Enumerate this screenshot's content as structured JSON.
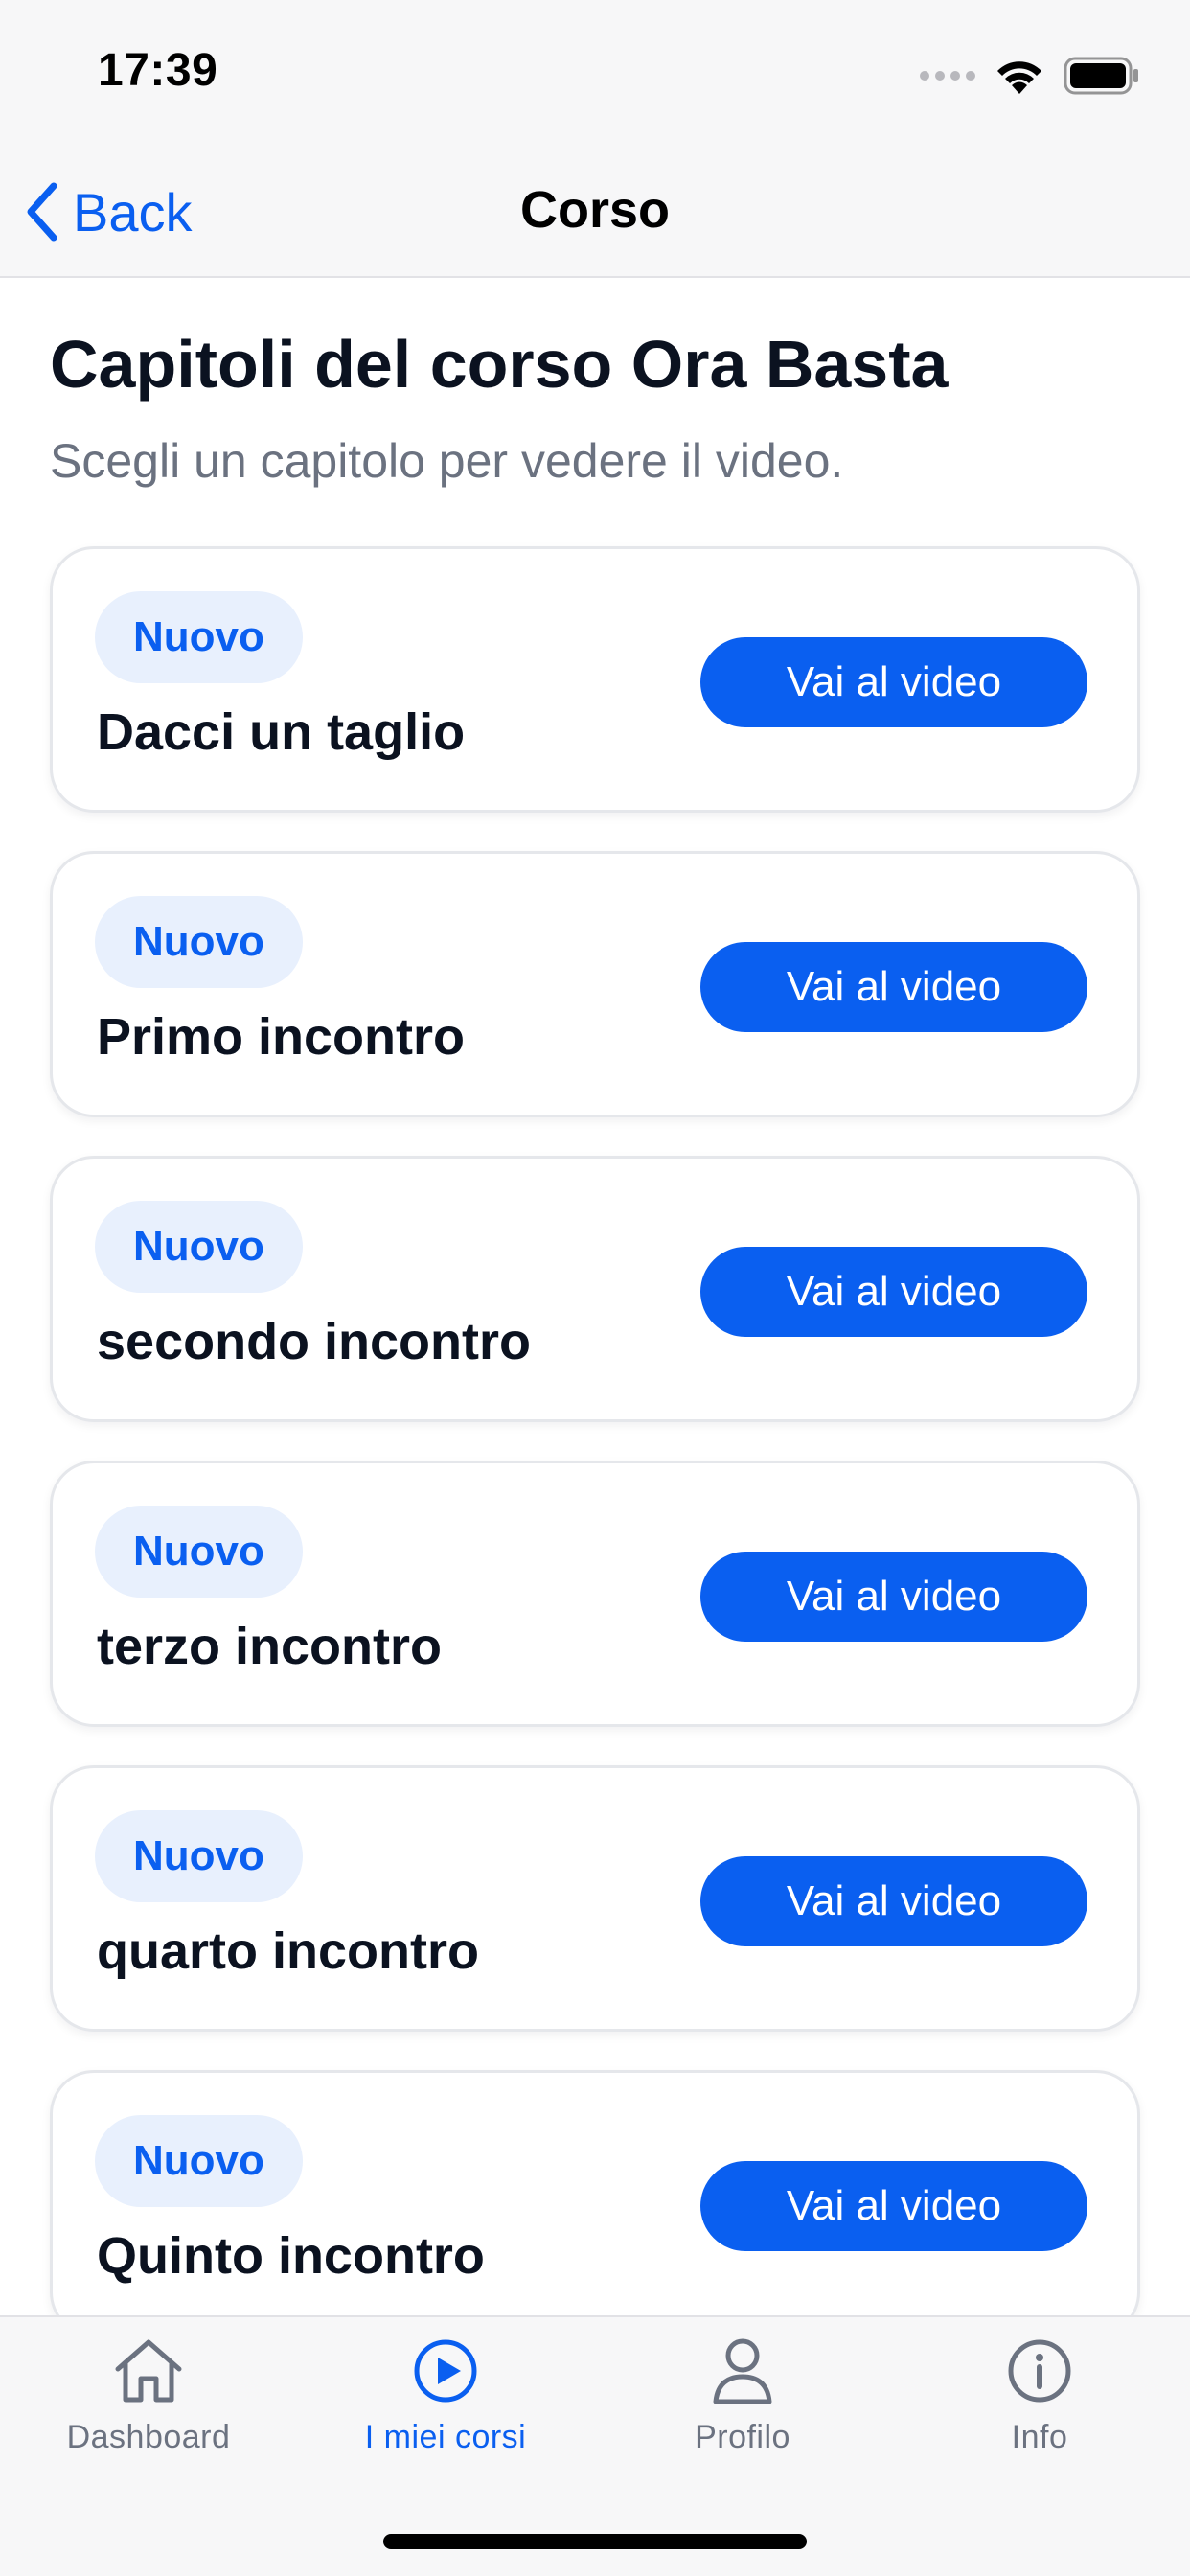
{
  "status_bar": {
    "time": "17:39"
  },
  "nav": {
    "back_label": "Back",
    "title": "Corso"
  },
  "header": {
    "title": "Capitoli del corso Ora Basta",
    "subtitle": "Scegli un capitolo per vedere il video."
  },
  "chapters": [
    {
      "badge": "Nuovo",
      "title": "Dacci un taglio",
      "button": "Vai al video"
    },
    {
      "badge": "Nuovo",
      "title": "Primo incontro",
      "button": "Vai al video"
    },
    {
      "badge": "Nuovo",
      "title": "secondo incontro",
      "button": "Vai al video"
    },
    {
      "badge": "Nuovo",
      "title": "terzo incontro",
      "button": "Vai al video"
    },
    {
      "badge": "Nuovo",
      "title": "quarto incontro",
      "button": "Vai al video"
    },
    {
      "badge": "Nuovo",
      "title": "Quinto incontro",
      "button": "Vai al video"
    }
  ],
  "tabs": [
    {
      "label": "Dashboard",
      "icon": "home-icon",
      "active": false
    },
    {
      "label": "I miei corsi",
      "icon": "play-circle-icon",
      "active": true
    },
    {
      "label": "Profilo",
      "icon": "person-icon",
      "active": false
    },
    {
      "label": "Info",
      "icon": "info-icon",
      "active": false
    }
  ],
  "colors": {
    "accent": "#0a5ff0",
    "badge_bg": "#e8f0fd",
    "muted": "#6b7280"
  }
}
